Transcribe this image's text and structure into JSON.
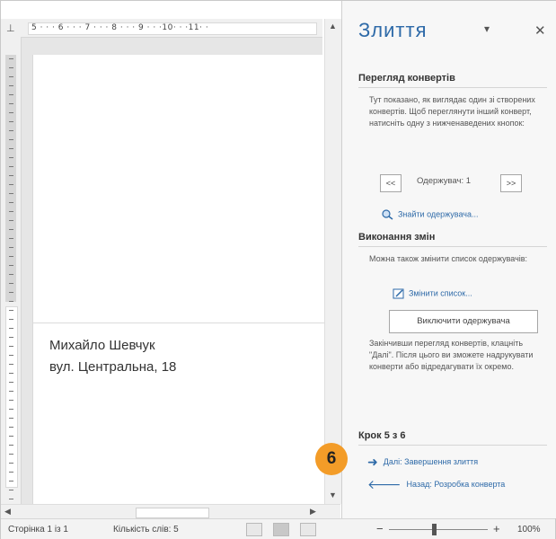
{
  "ruler": {
    "corner": "⊥",
    "marks": "5 · · · 6 · · · 7 · · · 8 · · · 9 · · ·10· · ·11· ·"
  },
  "document": {
    "address_line1": "Михайло Шевчук",
    "address_line2": "вул. Центральна, 18"
  },
  "pane": {
    "title": "Злиття",
    "dropdown_glyph": "▾",
    "close_glyph": "✕",
    "preview": {
      "heading": "Перегляд конвертів",
      "description": "Тут показано, як виглядає один зі створених конвертів. Щоб переглянути інший конверт, натисніть одну з нижченаведених кнопок:",
      "prev_label": "<<",
      "recipient_label": "Одержувач: 1",
      "next_label": ">>",
      "find_label": "Знайти одержувача..."
    },
    "changes": {
      "heading": "Виконання змін",
      "description": "Можна також змінити список одержувачів:",
      "edit_label": "Змінити список...",
      "exclude_label": "Виключити одержувача",
      "finish_text": "Закінчивши перегляд конвертів, клацніть \"Далі\". Після цього ви зможете надрукувати конверти або відредагувати їх окремо."
    },
    "step": {
      "heading": "Крок 5 з 6",
      "next_label": "Далі: Завершення злиття",
      "back_label": "Назад: Розробка конверта",
      "badge": "6"
    }
  },
  "status_bar": {
    "page": "Сторінка 1 із 1",
    "words": "Кількість слів: 5",
    "zoom_minus": "−",
    "zoom_plus": "+",
    "zoom": "100%"
  },
  "colors": {
    "accent": "#2e6aa8",
    "badge": "#f39c28"
  }
}
